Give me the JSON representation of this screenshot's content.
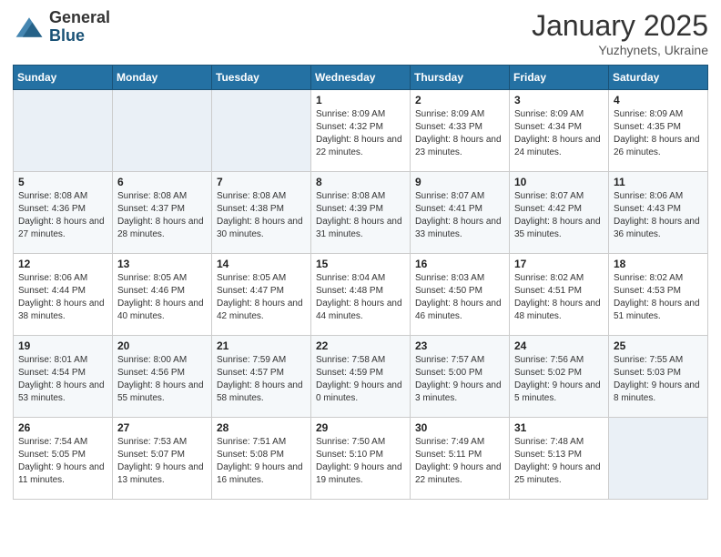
{
  "logo": {
    "general": "General",
    "blue": "Blue"
  },
  "header": {
    "month": "January 2025",
    "location": "Yuzhynets, Ukraine"
  },
  "weekdays": [
    "Sunday",
    "Monday",
    "Tuesday",
    "Wednesday",
    "Thursday",
    "Friday",
    "Saturday"
  ],
  "weeks": [
    [
      {
        "day": "",
        "sunrise": "",
        "sunset": "",
        "daylight": ""
      },
      {
        "day": "",
        "sunrise": "",
        "sunset": "",
        "daylight": ""
      },
      {
        "day": "",
        "sunrise": "",
        "sunset": "",
        "daylight": ""
      },
      {
        "day": "1",
        "sunrise": "Sunrise: 8:09 AM",
        "sunset": "Sunset: 4:32 PM",
        "daylight": "Daylight: 8 hours and 22 minutes."
      },
      {
        "day": "2",
        "sunrise": "Sunrise: 8:09 AM",
        "sunset": "Sunset: 4:33 PM",
        "daylight": "Daylight: 8 hours and 23 minutes."
      },
      {
        "day": "3",
        "sunrise": "Sunrise: 8:09 AM",
        "sunset": "Sunset: 4:34 PM",
        "daylight": "Daylight: 8 hours and 24 minutes."
      },
      {
        "day": "4",
        "sunrise": "Sunrise: 8:09 AM",
        "sunset": "Sunset: 4:35 PM",
        "daylight": "Daylight: 8 hours and 26 minutes."
      }
    ],
    [
      {
        "day": "5",
        "sunrise": "Sunrise: 8:08 AM",
        "sunset": "Sunset: 4:36 PM",
        "daylight": "Daylight: 8 hours and 27 minutes."
      },
      {
        "day": "6",
        "sunrise": "Sunrise: 8:08 AM",
        "sunset": "Sunset: 4:37 PM",
        "daylight": "Daylight: 8 hours and 28 minutes."
      },
      {
        "day": "7",
        "sunrise": "Sunrise: 8:08 AM",
        "sunset": "Sunset: 4:38 PM",
        "daylight": "Daylight: 8 hours and 30 minutes."
      },
      {
        "day": "8",
        "sunrise": "Sunrise: 8:08 AM",
        "sunset": "Sunset: 4:39 PM",
        "daylight": "Daylight: 8 hours and 31 minutes."
      },
      {
        "day": "9",
        "sunrise": "Sunrise: 8:07 AM",
        "sunset": "Sunset: 4:41 PM",
        "daylight": "Daylight: 8 hours and 33 minutes."
      },
      {
        "day": "10",
        "sunrise": "Sunrise: 8:07 AM",
        "sunset": "Sunset: 4:42 PM",
        "daylight": "Daylight: 8 hours and 35 minutes."
      },
      {
        "day": "11",
        "sunrise": "Sunrise: 8:06 AM",
        "sunset": "Sunset: 4:43 PM",
        "daylight": "Daylight: 8 hours and 36 minutes."
      }
    ],
    [
      {
        "day": "12",
        "sunrise": "Sunrise: 8:06 AM",
        "sunset": "Sunset: 4:44 PM",
        "daylight": "Daylight: 8 hours and 38 minutes."
      },
      {
        "day": "13",
        "sunrise": "Sunrise: 8:05 AM",
        "sunset": "Sunset: 4:46 PM",
        "daylight": "Daylight: 8 hours and 40 minutes."
      },
      {
        "day": "14",
        "sunrise": "Sunrise: 8:05 AM",
        "sunset": "Sunset: 4:47 PM",
        "daylight": "Daylight: 8 hours and 42 minutes."
      },
      {
        "day": "15",
        "sunrise": "Sunrise: 8:04 AM",
        "sunset": "Sunset: 4:48 PM",
        "daylight": "Daylight: 8 hours and 44 minutes."
      },
      {
        "day": "16",
        "sunrise": "Sunrise: 8:03 AM",
        "sunset": "Sunset: 4:50 PM",
        "daylight": "Daylight: 8 hours and 46 minutes."
      },
      {
        "day": "17",
        "sunrise": "Sunrise: 8:02 AM",
        "sunset": "Sunset: 4:51 PM",
        "daylight": "Daylight: 8 hours and 48 minutes."
      },
      {
        "day": "18",
        "sunrise": "Sunrise: 8:02 AM",
        "sunset": "Sunset: 4:53 PM",
        "daylight": "Daylight: 8 hours and 51 minutes."
      }
    ],
    [
      {
        "day": "19",
        "sunrise": "Sunrise: 8:01 AM",
        "sunset": "Sunset: 4:54 PM",
        "daylight": "Daylight: 8 hours and 53 minutes."
      },
      {
        "day": "20",
        "sunrise": "Sunrise: 8:00 AM",
        "sunset": "Sunset: 4:56 PM",
        "daylight": "Daylight: 8 hours and 55 minutes."
      },
      {
        "day": "21",
        "sunrise": "Sunrise: 7:59 AM",
        "sunset": "Sunset: 4:57 PM",
        "daylight": "Daylight: 8 hours and 58 minutes."
      },
      {
        "day": "22",
        "sunrise": "Sunrise: 7:58 AM",
        "sunset": "Sunset: 4:59 PM",
        "daylight": "Daylight: 9 hours and 0 minutes."
      },
      {
        "day": "23",
        "sunrise": "Sunrise: 7:57 AM",
        "sunset": "Sunset: 5:00 PM",
        "daylight": "Daylight: 9 hours and 3 minutes."
      },
      {
        "day": "24",
        "sunrise": "Sunrise: 7:56 AM",
        "sunset": "Sunset: 5:02 PM",
        "daylight": "Daylight: 9 hours and 5 minutes."
      },
      {
        "day": "25",
        "sunrise": "Sunrise: 7:55 AM",
        "sunset": "Sunset: 5:03 PM",
        "daylight": "Daylight: 9 hours and 8 minutes."
      }
    ],
    [
      {
        "day": "26",
        "sunrise": "Sunrise: 7:54 AM",
        "sunset": "Sunset: 5:05 PM",
        "daylight": "Daylight: 9 hours and 11 minutes."
      },
      {
        "day": "27",
        "sunrise": "Sunrise: 7:53 AM",
        "sunset": "Sunset: 5:07 PM",
        "daylight": "Daylight: 9 hours and 13 minutes."
      },
      {
        "day": "28",
        "sunrise": "Sunrise: 7:51 AM",
        "sunset": "Sunset: 5:08 PM",
        "daylight": "Daylight: 9 hours and 16 minutes."
      },
      {
        "day": "29",
        "sunrise": "Sunrise: 7:50 AM",
        "sunset": "Sunset: 5:10 PM",
        "daylight": "Daylight: 9 hours and 19 minutes."
      },
      {
        "day": "30",
        "sunrise": "Sunrise: 7:49 AM",
        "sunset": "Sunset: 5:11 PM",
        "daylight": "Daylight: 9 hours and 22 minutes."
      },
      {
        "day": "31",
        "sunrise": "Sunrise: 7:48 AM",
        "sunset": "Sunset: 5:13 PM",
        "daylight": "Daylight: 9 hours and 25 minutes."
      },
      {
        "day": "",
        "sunrise": "",
        "sunset": "",
        "daylight": ""
      }
    ]
  ]
}
